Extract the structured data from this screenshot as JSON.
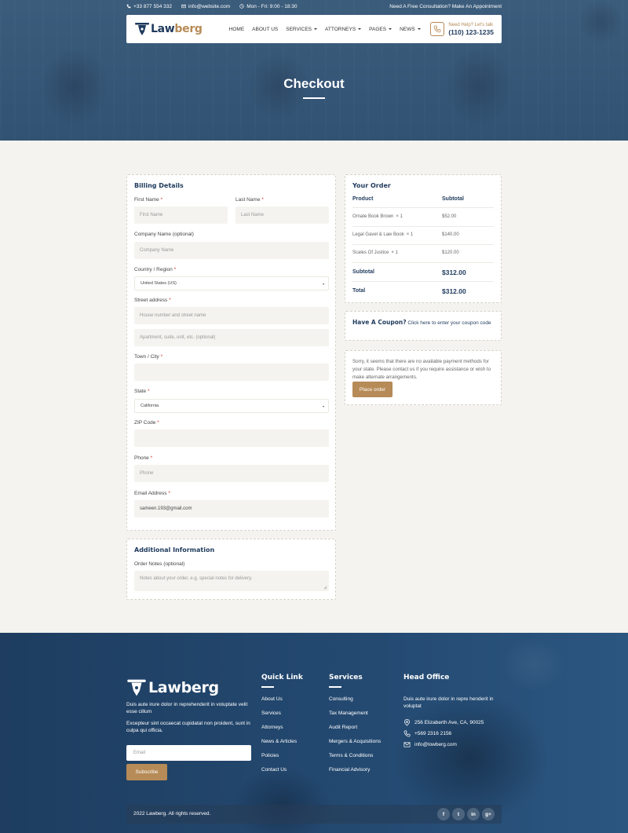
{
  "topbar": {
    "phone": "+33 877 554 332",
    "email": "info@website.com",
    "hours": "Mon - Fri: 9:00 - 18:30",
    "appointment": "Need A Free Consultation? Make An Appointment"
  },
  "brand": {
    "name_first": "Law",
    "name_rest": "berg"
  },
  "nav": {
    "items": [
      "HOME",
      "ABOUT US",
      "SERVICES",
      "ATTORNEYS",
      "PAGES",
      "NEWS"
    ],
    "help_label": "Need Help? Let's talk",
    "help_phone": "(110) 123-1235"
  },
  "hero": {
    "title": "Checkout"
  },
  "billing": {
    "title": "Billing Details",
    "first_name_label": "First Name",
    "first_name_placeholder": "First Name",
    "last_name_label": "Last Name",
    "last_name_placeholder": "Last Name",
    "company_label": "Company Name (optional)",
    "company_placeholder": "Company Name",
    "country_label": "Country / Region",
    "country_value": "United States (US)",
    "street_label": "Street address",
    "street_placeholder_1": "House number and street name",
    "street_placeholder_2": "Apartment, suite, unit, etc. (optional)",
    "town_label": "Town / City",
    "state_label": "State",
    "state_value": "California",
    "zip_label": "ZIP Code",
    "phone_label": "Phone",
    "phone_placeholder": "Phone",
    "email_label": "Email Address",
    "email_value": "sameen.193@gmail.com",
    "required_mark": "*"
  },
  "additional": {
    "title": "Additional Information",
    "notes_label": "Order Notes (optional)",
    "notes_placeholder": "Notes about your order, e.g. special notes for delivery."
  },
  "order": {
    "title": "Your Order",
    "col_product": "Product",
    "col_subtotal": "Subtotal",
    "items": [
      {
        "name": "Ornate Book Brown",
        "qty": "× 1",
        "price": "$52.00"
      },
      {
        "name": "Legal Gavel & Law Book",
        "qty": "× 1",
        "price": "$140.00"
      },
      {
        "name": "Scales Of Justice",
        "qty": "× 1",
        "price": "$120.00"
      }
    ],
    "subtotal_label": "Subtotal",
    "subtotal_value": "$312.00",
    "total_label": "Total",
    "total_value": "$312.00"
  },
  "coupon": {
    "title": "Have A Coupon?",
    "link": "Click here to enter your coupon code"
  },
  "payment": {
    "message": "Sorry, it seems that there are no available payment methods for your state. Please contact us if you require assistance or wish to make alternate arrangements.",
    "button": "Place order"
  },
  "footer": {
    "about_1": "Duis aute irure dolor in reprehenderit in voluptate velit esse cillum",
    "about_2": "Excepteur sint occaecat cupidatat non proident, sunt in culpa qui officia.",
    "email_placeholder": "Email",
    "subscribe": "Subscribe",
    "quick_title": "Quick Link",
    "quick_links": [
      "About Us",
      "Services",
      "Attorneys",
      "News & Articles",
      "Policies",
      "Contact Us"
    ],
    "services_title": "Services",
    "services_links": [
      "Consulting",
      "Tax Management",
      "Audit Report",
      "Mergers & Acquisitions",
      "Terms & Conditions",
      "Financial Advisory"
    ],
    "office_title": "Head Office",
    "office_text": "Duis aute irure dolor in repre henderit in voluptat",
    "address": "256 Elizaberth Ave, CA, 90025",
    "phone": "+569 2316 2156",
    "email": "info@lowberg.com",
    "copyright": "2022 Lawberg. All rights reserved.",
    "social": [
      "f",
      "t",
      "in",
      "g+"
    ]
  },
  "colors": {
    "accent": "#b68b57",
    "navy": "#1f3a5c",
    "required": "#d8342c",
    "page_bg": "#f4f3ef"
  }
}
